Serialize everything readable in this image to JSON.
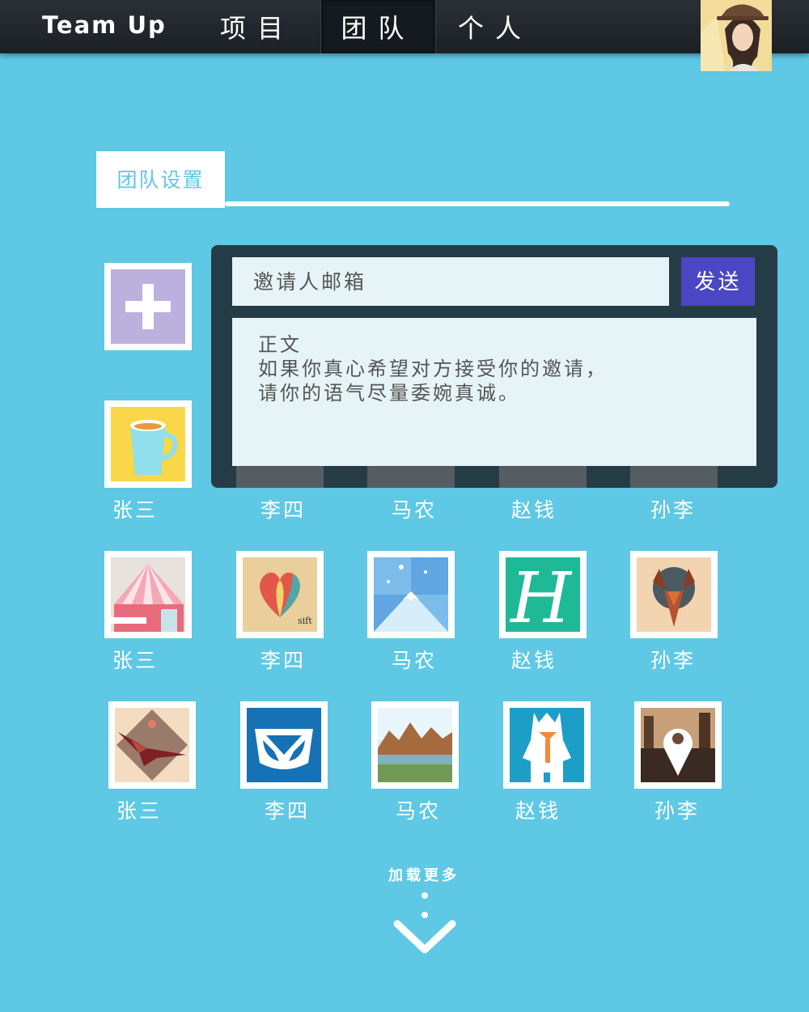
{
  "app": {
    "brand": "Team Up"
  },
  "nav": {
    "tabs": [
      {
        "label": "项目",
        "active": false
      },
      {
        "label": "团队",
        "active": true
      },
      {
        "label": "个人",
        "active": false
      }
    ]
  },
  "section": {
    "tab_label": "团队设置"
  },
  "invite": {
    "email_placeholder": "邀请人邮箱",
    "send_label": "发送",
    "body_title": "正文",
    "body_line1": "如果你真心希望对方接受你的邀请，",
    "body_line2": "请你的语气尽量委婉真诚。"
  },
  "members": {
    "row1": [
      "张三",
      "李四",
      "马农",
      "赵钱",
      "孙李"
    ],
    "row2": [
      "张三",
      "李四",
      "马农",
      "赵钱",
      "孙李"
    ],
    "row3": [
      "张三",
      "李四",
      "马农",
      "赵钱",
      "孙李"
    ]
  },
  "footer": {
    "load_more": "加载更多"
  },
  "colors": {
    "background": "#5ec8e5",
    "panel": "#253c47",
    "send_button": "#4a46c4",
    "add_tile": "#bcb0df"
  }
}
